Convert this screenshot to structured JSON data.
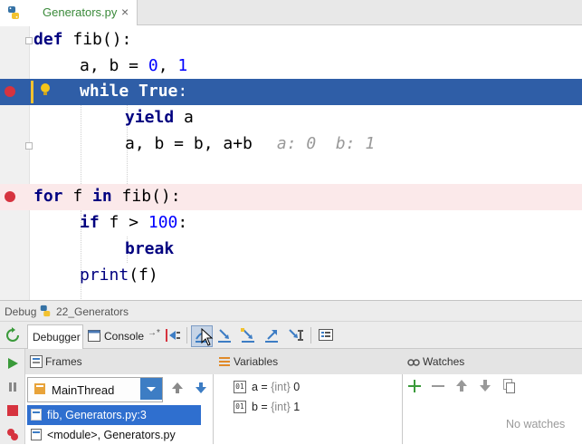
{
  "editor_tab": {
    "file_name": "Generators.py",
    "close_glyph": "×"
  },
  "code": {
    "line1": {
      "kw": "def",
      "rest": " fib():"
    },
    "line2": {
      "a": "a, b = ",
      "n0": "0",
      "comma": ", ",
      "n1": "1"
    },
    "line3": {
      "kw1": "while",
      "sp": " ",
      "kw2": "True",
      "colon": ":"
    },
    "line4": {
      "kw": "yield",
      "rest": " a"
    },
    "line5": {
      "code": "a, b = b, a+b",
      "inline_values": "a: 0  b: 1"
    },
    "line7": {
      "kw1": "for",
      "mid": " f ",
      "kw2": "in",
      "rest": " fib():"
    },
    "line8": {
      "kw": "if",
      "mid": " f > ",
      "num": "100",
      "colon": ":"
    },
    "line9": {
      "kw": "break"
    },
    "line10": {
      "fn": "print",
      "rest": "(f)"
    }
  },
  "debug": {
    "title": "Debug",
    "run_config": "22_Generators",
    "tabs": {
      "debugger": "Debugger",
      "console": "Console"
    },
    "frames": {
      "title": "Frames",
      "thread": "MainThread",
      "items": [
        {
          "label": "fib, Generators.py:3"
        },
        {
          "label": "<module>, Generators.py"
        }
      ]
    },
    "variables": {
      "title": "Variables",
      "items": [
        {
          "name": "a",
          "eq": " = ",
          "type": "{int}",
          "value": " 0"
        },
        {
          "name": "b",
          "eq": " = ",
          "type": "{int}",
          "value": " 1"
        }
      ]
    },
    "watches": {
      "title": "Watches",
      "empty_text": "No watches"
    }
  },
  "colors": {
    "accent": "#2f5ea7",
    "breakpoint": "#d6333f",
    "selection": "#2f6fcf",
    "tab_text": "#3a8a3a"
  }
}
